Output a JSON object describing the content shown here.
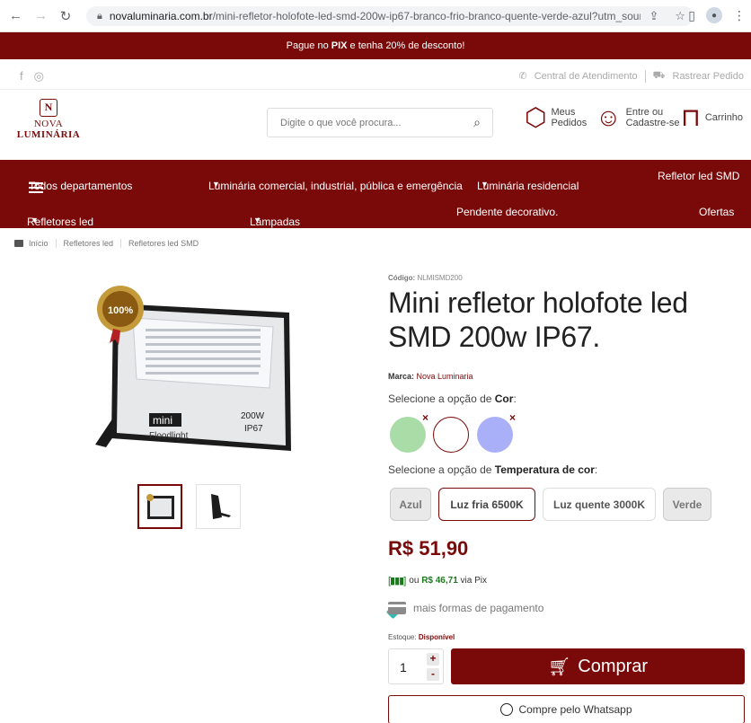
{
  "browser": {
    "url_main": "novaluminaria.com.br",
    "url_rest": "/mini-refletor-holofote-led-smd-200w-ip67-branco-frio-branco-quente-verde-azul?utm_source=Sit..."
  },
  "promo": {
    "pre": "Pague no ",
    "bold": "PIX",
    "post": " e tenha 20% de desconto!"
  },
  "utility": {
    "support": "Central de Atendimento",
    "track": "Rastrear Pedido"
  },
  "logo": {
    "mark": "N",
    "line1": "NOVA",
    "line2": "LUMINÁRIA"
  },
  "search": {
    "placeholder": "Digite o que você procura..."
  },
  "header_links": {
    "orders_1": "Meus",
    "orders_2": "Pedidos",
    "login_1": "Entre ou",
    "login_2": "Cadastre-se",
    "cart": "Carrinho"
  },
  "nav": {
    "all": "Todos departamentos",
    "commercial": "Luminária comercial, industrial, pública e emergência",
    "residential": "Luminária residencial",
    "smd": "Refletor led SMD",
    "reflectors": "Refletores led",
    "lamps": "Lâmpadas",
    "pendant": "Pendente decorativo.",
    "offers": "Ofertas"
  },
  "breadcrumb": [
    "Início",
    "Refletores led",
    "Refletores led SMD"
  ],
  "product_image": {
    "badge": "100%",
    "label_mini": "mini",
    "label_floodlight": "Floodlight",
    "label_watt": "200W",
    "label_ip": "IP67"
  },
  "product": {
    "code_label": "Código:",
    "code": "NLMISMD200",
    "title": "Mini refletor holofote led SMD 200w IP67.",
    "brand_label": "Marca:",
    "brand": "Nova Luminaria",
    "color_label_pre": "Selecione a opção de ",
    "color_label_bold": "Cor",
    "color_label_post": ":",
    "temp_label_pre": "Selecione a opção de ",
    "temp_label_bold": "Temperatura de cor",
    "temp_label_post": ":",
    "swatch_x": "×",
    "temps": [
      "Azul",
      "Luz fria 6500K",
      "Luz quente 3000K",
      "Verde"
    ],
    "price": "R$ 51,90",
    "pix_pre": "ou ",
    "pix_value": "R$ 46,71",
    "pix_post": " via Pix",
    "payment": "mais formas de pagamento",
    "stock_label": "Estoque: ",
    "stock": "Disponível",
    "qty": "1",
    "plus": "+",
    "minus": "-",
    "buy": "Comprar",
    "whatsapp": "Compre pelo Whatsapp"
  },
  "colors": {
    "brand": "#7a0a0a",
    "swatch_green": "#a9dca6",
    "swatch_blue": "#aab0f7"
  }
}
